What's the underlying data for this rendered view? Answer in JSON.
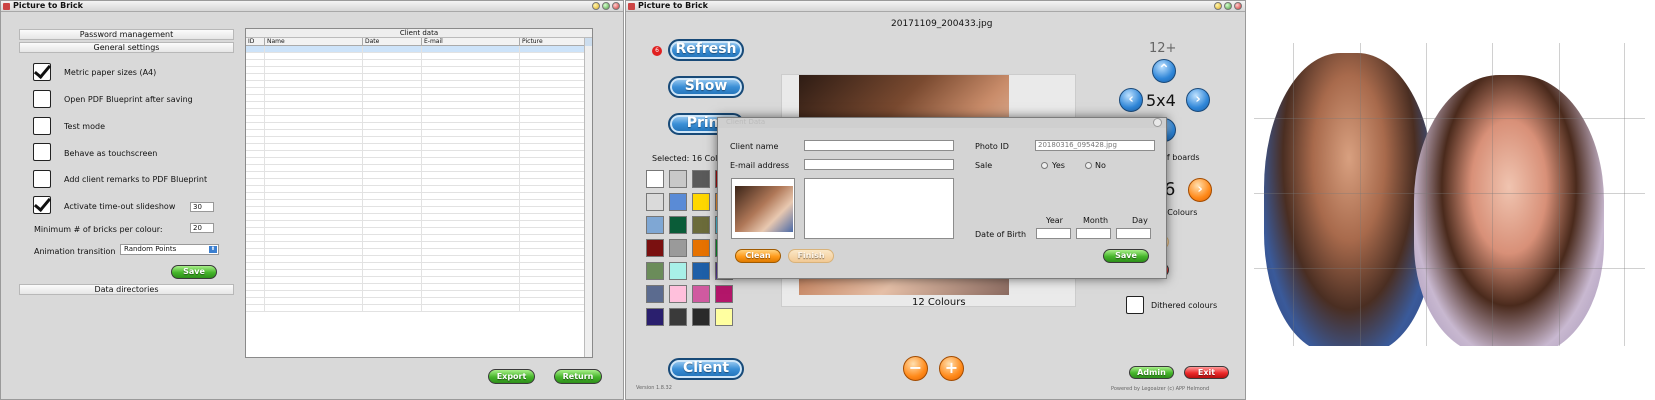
{
  "window1": {
    "title": "Picture to Brick"
  },
  "settings": {
    "password_section": "Password management",
    "general_section": "General settings",
    "options": [
      {
        "label": "Metric paper sizes (A4)",
        "checked": true
      },
      {
        "label": "Open PDF Blueprint after saving",
        "checked": false
      },
      {
        "label": "Test mode",
        "checked": false
      },
      {
        "label": "Behave as touchscreen",
        "checked": false
      },
      {
        "label": "Add client remarks to PDF Blueprint",
        "checked": false
      },
      {
        "label": "Activate time-out slideshow",
        "checked": true
      }
    ],
    "timeout_value": "30",
    "min_bricks_label": "Minimum # of bricks per colour:",
    "min_bricks_value": "20",
    "animation_label": "Animation transition",
    "animation_value": "Random Points",
    "save_label": "Save",
    "data_dirs_section": "Data directories"
  },
  "client_table": {
    "caption": "Client data",
    "columns": [
      "ID",
      "Name",
      "Date",
      "E-mail",
      "Picture"
    ]
  },
  "window1_buttons": {
    "export": "Export",
    "return": "Return"
  },
  "window2": {
    "title": "Picture to Brick",
    "filename": "20171109_200433.jpg",
    "refresh_badge": "6"
  },
  "main": {
    "refresh": "Refresh",
    "show": "Show",
    "print": "Print",
    "selected": "Selected: 16 Colours",
    "colour_count": "12 Colours",
    "size_top": "12+",
    "size": "5x4",
    "boards_label": "of boards",
    "colours_value": "6",
    "colours_label": "of Colours",
    "dithered_label": "Dithered colours",
    "client": "Client",
    "minus": "−",
    "plus": "+",
    "admin": "Admin",
    "exit": "Exit",
    "reset_partial": "et",
    "filter_partial": "ter",
    "version": "Version 1.8.32",
    "powered": "Powered by Legoaizer (c) APP Helmond"
  },
  "palette": [
    "#ffffff",
    "#c8c8c8",
    "#5a5a5a",
    "#b30f0f",
    "#dadada",
    "#5a8bd6",
    "#ffd700",
    "#ff9933",
    "#7fa7d4",
    "#0a5c38",
    "#6b6b3a",
    "#4ec9e6",
    "#7a1010",
    "#9a9a9a",
    "#e67200",
    "#0a9e32",
    "#6b8c5a",
    "#a8f0e8",
    "#1e5fa8",
    "#5b3a9e",
    "#5b6b8f",
    "#ffc0dc",
    "#d05aa0",
    "#b3166a",
    "#2a1f6e",
    "#3a3a3a",
    "#2a2a2a",
    "#ffffa0"
  ],
  "dialog": {
    "title": "Client Data",
    "client_name_label": "Client name",
    "email_label": "E-mail address",
    "photo_id_label": "Photo ID",
    "photo_id_value": "20180316_095428.jpg",
    "sale_label": "Sale",
    "yes": "Yes",
    "no": "No",
    "year": "Year",
    "month": "Month",
    "day": "Day",
    "dob_label": "Date of Birth",
    "clean": "Clean",
    "finish": "Finish",
    "save": "Save"
  }
}
